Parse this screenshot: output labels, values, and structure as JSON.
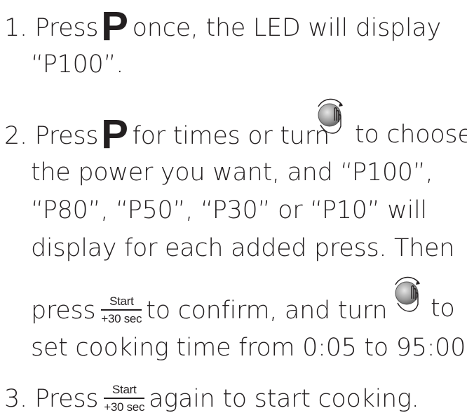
{
  "step1": {
    "prefix": "1. Press",
    "key": "P",
    "suffix": "once, the LED will display",
    "line2": "“P100”."
  },
  "step2": {
    "prefix": "2. Press",
    "key": "P",
    "mid": "for times or turn",
    "suffix": "to choose",
    "line2": "the power you want, and “P100”,",
    "line3": "“P80”, “P50”, “P30” or “P10” will",
    "line4": "display for each added press. Then",
    "line5_prefix": "press",
    "line5_mid": "to confirm, and turn",
    "line5_suffix": "to",
    "line6": "set cooking time from 0:05 to 95:00."
  },
  "step3": {
    "prefix": "3. Press",
    "suffix": "again to start cooking."
  },
  "start_button": {
    "top": "Start",
    "bottom": "+30 sec"
  },
  "icons": {
    "power_key": "bold-p-key",
    "dial": "hand-turning-knob-icon"
  }
}
